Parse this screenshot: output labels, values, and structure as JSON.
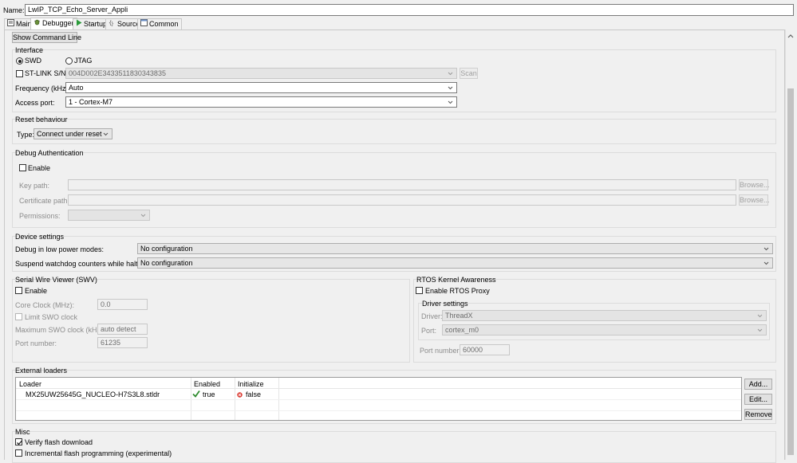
{
  "name_row": {
    "label": "Name:",
    "value": "LwIP_TCP_Echo_Server_Appli"
  },
  "tabs": [
    {
      "label": "Main",
      "icon": "main-tab-icon"
    },
    {
      "label": "Debugger",
      "icon": "debugger-tab-icon",
      "active": true
    },
    {
      "label": "Startup",
      "icon": "startup-play-icon"
    },
    {
      "label": "Source",
      "icon": "source-tab-icon"
    },
    {
      "label": "Common",
      "icon": "common-tab-icon"
    }
  ],
  "show_command_line": "Show Command Line",
  "interface": {
    "title": "Interface",
    "swd": "SWD",
    "jtag": "JTAG",
    "selected": "SWD",
    "stlink_label": "ST-LINK S/N",
    "stlink_value": "004D002E3433511830343835",
    "scan": "Scan",
    "frequency_label": "Frequency (kHz):",
    "frequency_value": "Auto",
    "access_port_label": "Access port:",
    "access_port_value": "1 - Cortex-M7"
  },
  "reset": {
    "title": "Reset behaviour",
    "type_label": "Type:",
    "type_value": "Connect under reset"
  },
  "debug_auth": {
    "title": "Debug Authentication",
    "enable": "Enable",
    "key_path": "Key path:",
    "cert_path": "Certificate path:",
    "permissions": "Permissions:",
    "browse": "Browse..."
  },
  "device": {
    "title": "Device settings",
    "low_power_label": "Debug in low power modes:",
    "low_power_value": "No configuration",
    "watchdog_label": "Suspend watchdog counters while halted:",
    "watchdog_value": "No configuration"
  },
  "swv": {
    "title": "Serial Wire Viewer (SWV)",
    "enable": "Enable",
    "core_clock_label": "Core Clock (MHz):",
    "core_clock_value": "0.0",
    "limit_swo": "Limit SWO clock",
    "max_swo_label": "Maximum SWO clock (kHz):",
    "max_swo_value": "auto detect",
    "port_label": "Port number:",
    "port_value": "61235"
  },
  "rtos": {
    "title": "RTOS Kernel Awareness",
    "enable_proxy": "Enable RTOS Proxy",
    "driver_settings": "Driver settings",
    "driver_label": "Driver:",
    "driver_value": "ThreadX",
    "port_label": "Port:",
    "port_value": "cortex_m0",
    "port_number_label": "Port number:",
    "port_number_value": "60000"
  },
  "loaders": {
    "title": "External loaders",
    "columns": [
      "Loader",
      "Enabled",
      "Initialize"
    ],
    "rows": [
      {
        "loader": "MX25UW25645G_NUCLEO-H7S3L8.stldr",
        "enabled": "true",
        "initialize": "false"
      }
    ],
    "add": "Add...",
    "edit": "Edit...",
    "remove": "Remove"
  },
  "misc": {
    "title": "Misc",
    "verify": "Verify flash download",
    "verify_checked": true,
    "incremental": "Incremental flash programming (experimental)",
    "incremental_checked": false
  },
  "colors": {
    "check_green": "#2e8b2e",
    "cross_red": "#d9342b",
    "play_green": "#2a9b3a"
  }
}
